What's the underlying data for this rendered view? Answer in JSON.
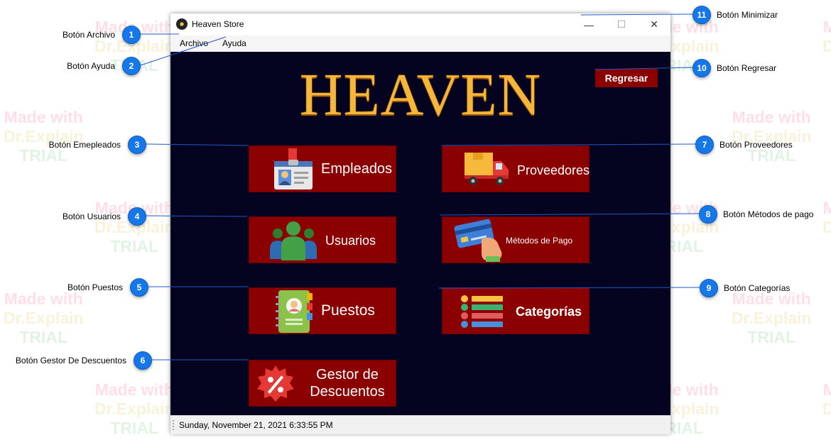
{
  "watermark": {
    "line1": "Made with",
    "line2": "Dr.Explain",
    "line3": "TRIAL"
  },
  "window": {
    "title": "Heaven Store",
    "controls": {
      "minimize": "—",
      "maximize": "☐",
      "close": "✕"
    }
  },
  "menu": {
    "archivo": "Archivo",
    "ayuda": "Ayuda"
  },
  "main": {
    "title": "HEAVEN",
    "back_button": "Regresar",
    "buttons": {
      "empleados": "Empleados",
      "proveedores": "Proveedores",
      "usuarios": "Usuarios",
      "metodos_pago": "Métodos de Pago",
      "puestos": "Puestos",
      "categorias": "Categorías",
      "gestor_line1": "Gestor de",
      "gestor_line2": "Descuentos"
    }
  },
  "status": {
    "datetime": "Sunday, November 21, 2021   6:33:55 PM"
  },
  "annotations": [
    {
      "number": "1",
      "label": "Botón Archivo"
    },
    {
      "number": "2",
      "label": "Botón Ayuda"
    },
    {
      "number": "3",
      "label": "Botón Emepleados"
    },
    {
      "number": "4",
      "label": "Botón Usuarios"
    },
    {
      "number": "5",
      "label": "Botón Puestos"
    },
    {
      "number": "6",
      "label": "Botón Gestor De Descuentos"
    },
    {
      "number": "7",
      "label": "Botón Proveedores"
    },
    {
      "number": "8",
      "label": "Botón Métodos de pago"
    },
    {
      "number": "9",
      "label": "Botón Categorías"
    },
    {
      "number": "10",
      "label": "Botón Regresar"
    },
    {
      "number": "11",
      "label": "Botón Minimizar"
    }
  ],
  "colors": {
    "window_bg": "#050420",
    "button_red": "#8b0000",
    "title_gold": "#f5b73b",
    "badge_blue": "#1677e8"
  }
}
